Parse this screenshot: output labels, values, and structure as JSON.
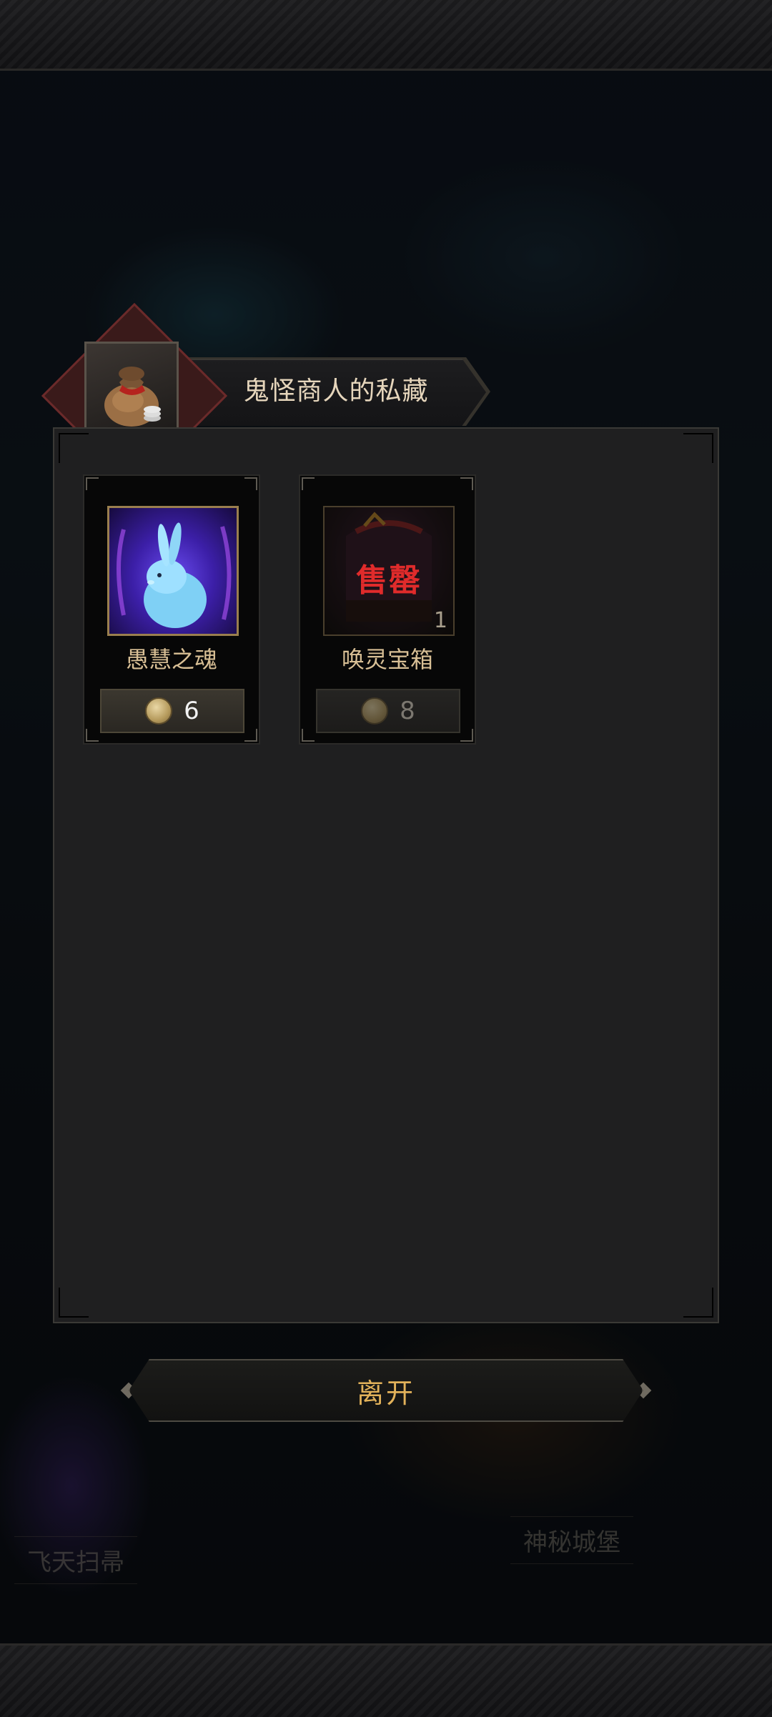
{
  "dialog": {
    "title": "鬼怪商人的私藏",
    "icon": "merchant-bag-icon"
  },
  "items": [
    {
      "name": "愚慧之魂",
      "icon": "spirit-rabbit-icon",
      "price": "6",
      "currency_icon": "coin-icon",
      "sold_out": false
    },
    {
      "name": "唤灵宝箱",
      "icon": "summoning-chest-icon",
      "price": "8",
      "currency_icon": "coin-icon",
      "sold_out": true,
      "sold_label": "售罄",
      "quantity": "1"
    }
  ],
  "buttons": {
    "leave": "离开"
  },
  "map": {
    "label_left": "飞天扫帚",
    "label_right": "神秘城堡"
  },
  "colors": {
    "accent_gold": "#e2b25a",
    "sold_red": "#e02b2b",
    "panel_bg": "#1f1f20"
  }
}
